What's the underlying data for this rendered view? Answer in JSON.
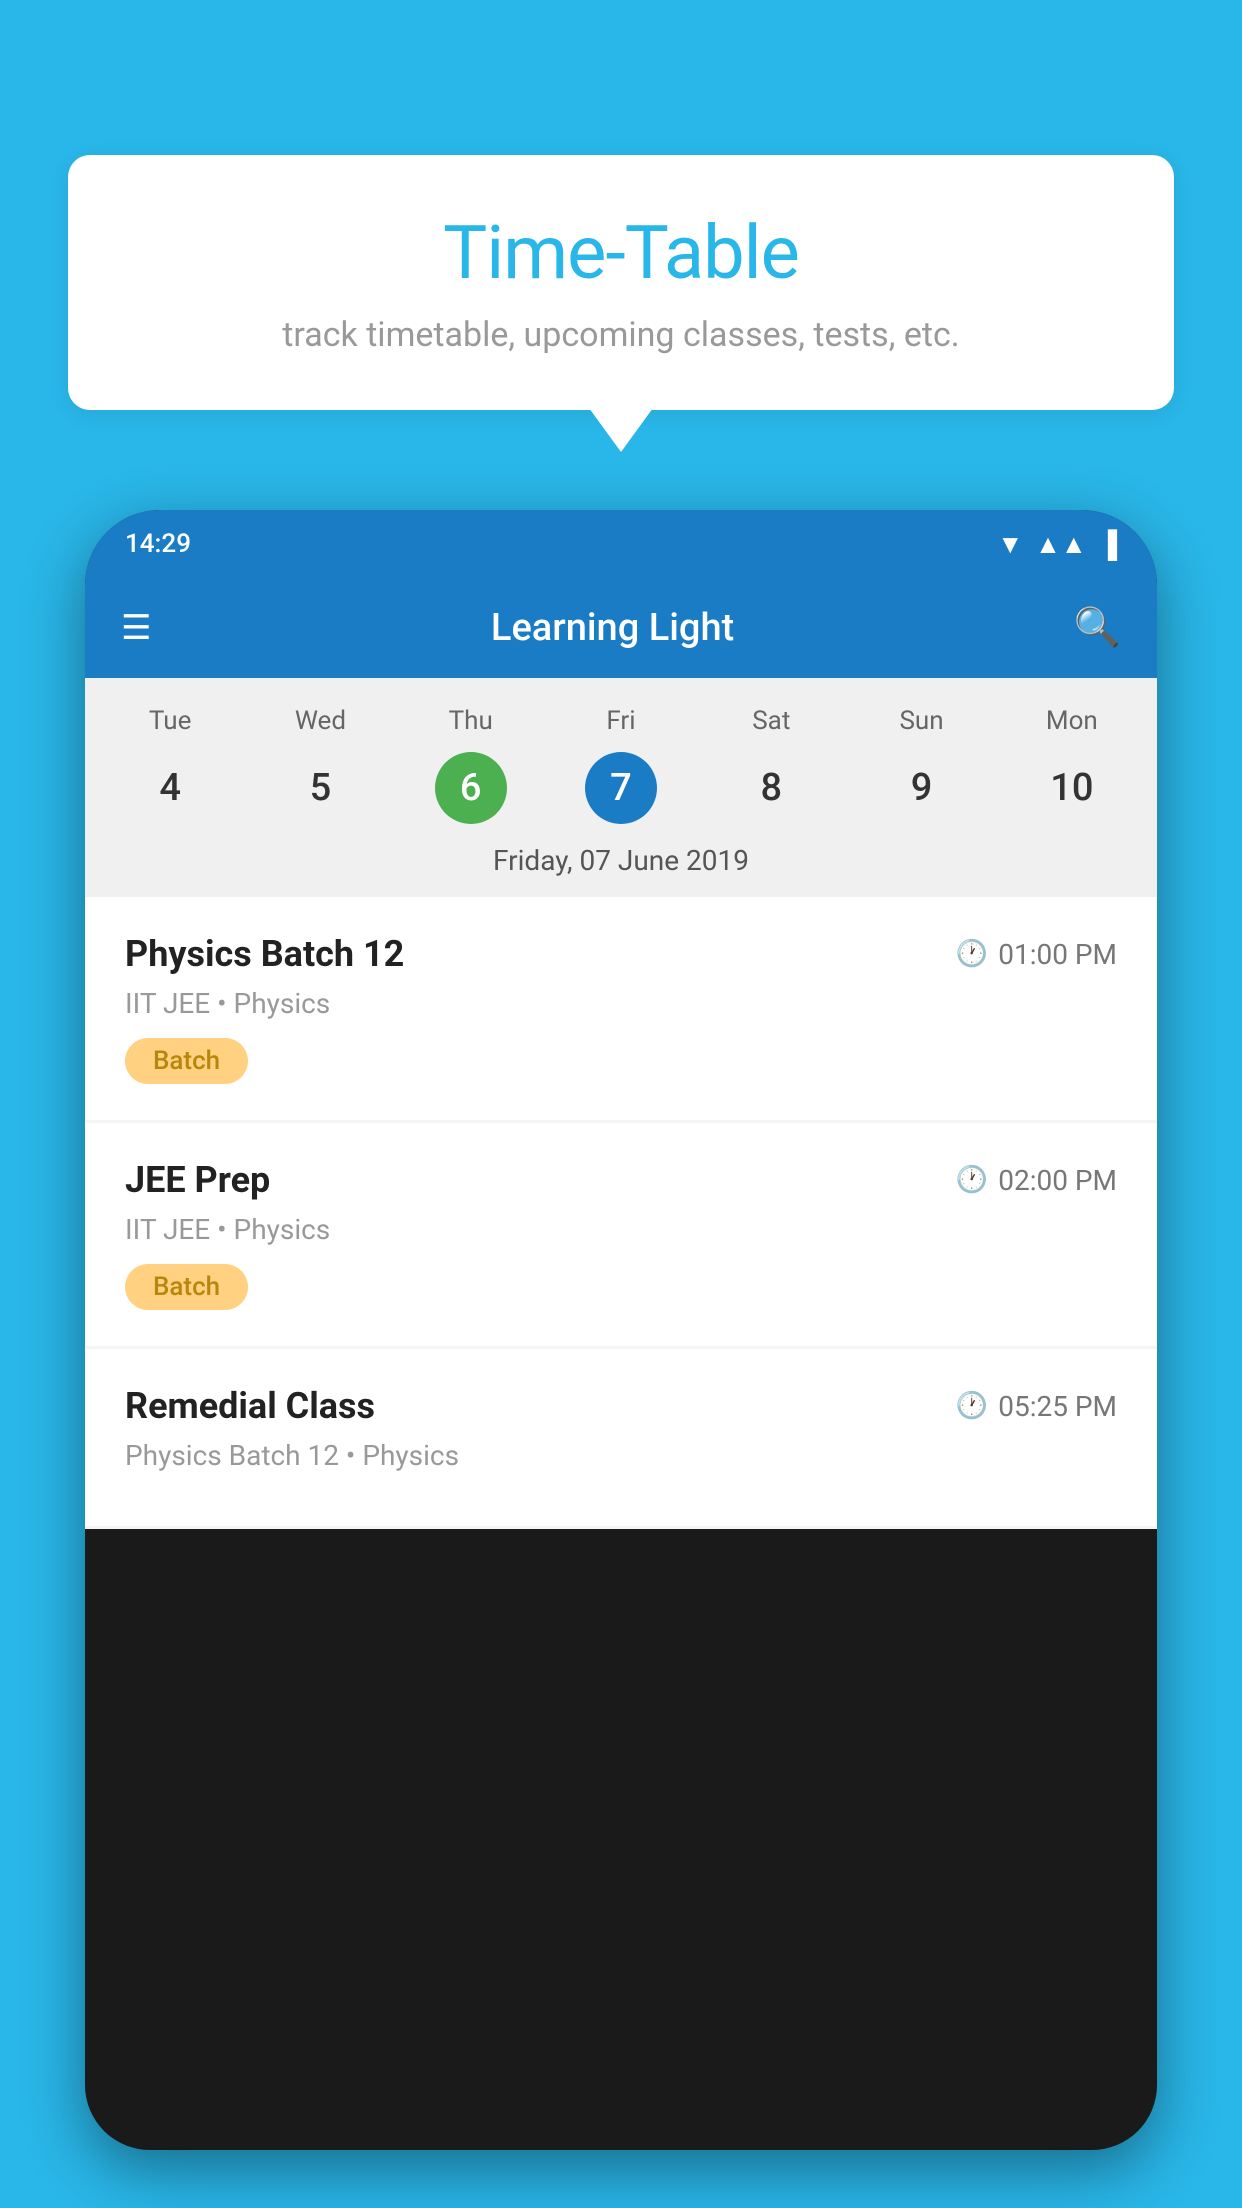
{
  "background_color": "#29b6e8",
  "bubble": {
    "title": "Time-Table",
    "subtitle": "track timetable, upcoming classes, tests, etc."
  },
  "phone": {
    "status_bar": {
      "time": "14:29"
    },
    "app_bar": {
      "title": "Learning Light"
    },
    "calendar": {
      "days": [
        {
          "label": "Tue",
          "number": "4"
        },
        {
          "label": "Wed",
          "number": "5"
        },
        {
          "label": "Thu",
          "number": "6",
          "state": "today"
        },
        {
          "label": "Fri",
          "number": "7",
          "state": "selected"
        },
        {
          "label": "Sat",
          "number": "8"
        },
        {
          "label": "Sun",
          "number": "9"
        },
        {
          "label": "Mon",
          "number": "10"
        }
      ],
      "selected_date": "Friday, 07 June 2019"
    },
    "schedule": [
      {
        "title": "Physics Batch 12",
        "time": "01:00 PM",
        "subtitle": "IIT JEE • Physics",
        "badge": "Batch"
      },
      {
        "title": "JEE Prep",
        "time": "02:00 PM",
        "subtitle": "IIT JEE • Physics",
        "badge": "Batch"
      },
      {
        "title": "Remedial Class",
        "time": "05:25 PM",
        "subtitle": "Physics Batch 12 • Physics",
        "badge": null
      }
    ]
  }
}
